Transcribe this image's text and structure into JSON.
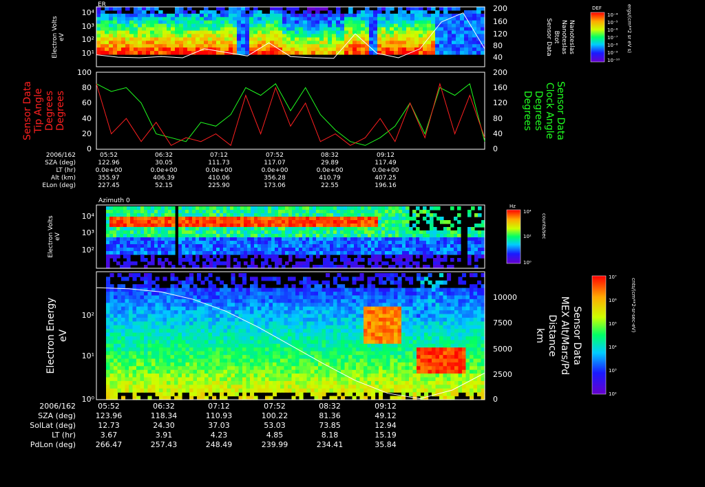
{
  "panel1": {
    "label": "ER",
    "ylabel_left": [
      "Electron Volts",
      "eV"
    ],
    "y_ticks": [
      "10⁴",
      "10³",
      "10²",
      "10¹"
    ],
    "y_right_ticks": [
      "200",
      "160",
      "120",
      "80",
      "40"
    ],
    "ylabel_right": [
      "Sensor Data",
      "Btot",
      "Nanoteslas",
      "Nanoteslas"
    ],
    "colorbar_title": "DEF",
    "colorbar_ticks": [
      "10⁻⁴",
      "10⁻⁵",
      "10⁻⁶",
      "10⁻⁷",
      "10⁻⁸",
      "10⁻⁹",
      "10⁻¹⁰"
    ],
    "colorbar_units": "ergs/(cm**2 sr eV s)"
  },
  "panel2": {
    "y_left_ticks": [
      "100",
      "80",
      "60",
      "40",
      "20",
      "0"
    ],
    "y_right_ticks": [
      "200",
      "160",
      "120",
      "80",
      "40",
      "0"
    ],
    "ylabel_left": [
      "Sensor Data",
      "Tip Angle",
      "Degrees",
      "Degrees"
    ],
    "ylabel_right": [
      "Sensor Data",
      "Clock Angle",
      "Degrees",
      "Degrees"
    ],
    "colors": {
      "tip": "#ff2020",
      "clock": "#20ff20"
    }
  },
  "table1": {
    "rows": [
      [
        "2006/162",
        "05:52",
        "06:32",
        "07:12",
        "07:52",
        "08:32",
        "09:12"
      ],
      [
        "SZA (deg)",
        "122.96",
        "30.05",
        "111.73",
        "117.07",
        "29.89",
        "117.49"
      ],
      [
        "LT (hr)",
        "0.0e+00",
        "0.0e+00",
        "0.0e+00",
        "0.0e+00",
        "0.0e+00",
        "0.0e+00"
      ],
      [
        "Alt (km)",
        "355.97",
        "406.39",
        "410.06",
        "356.28",
        "410.79",
        "407.25"
      ],
      [
        "ELon (deg)",
        "227.45",
        "52.15",
        "225.90",
        "173.06",
        "22.55",
        "196.16"
      ]
    ]
  },
  "panel3": {
    "title": "Azimuth 0",
    "ylabel": [
      "Electron Volts",
      "eV"
    ],
    "y_ticks": [
      "10⁴",
      "10³",
      "10²"
    ],
    "colorbar_title": "Hz",
    "colorbar_ticks": [
      "10⁴",
      "10²",
      "10⁰"
    ],
    "colorbar_units": "counts/sec"
  },
  "panel4": {
    "ylabel_left": [
      "Electron Energy",
      "eV"
    ],
    "y_ticks": [
      "10²",
      "10¹",
      "10⁰"
    ],
    "y_right_ticks": [
      "10000",
      "7500",
      "5000",
      "2500",
      "0"
    ],
    "ylabel_right": [
      "Sensor Data",
      "MEX Alt/Mars/Pd",
      "Distance",
      "km"
    ],
    "colorbar_ticks": [
      "10⁷",
      "10⁶",
      "10⁵",
      "10⁴",
      "10³",
      "10²"
    ],
    "colorbar_units": "cnts/(cm**2-sr-sec-eV)"
  },
  "table2": {
    "rows": [
      [
        "2006/162",
        "05:52",
        "06:32",
        "07:12",
        "07:52",
        "08:32",
        "09:12"
      ],
      [
        "SZA (deg)",
        "123.96",
        "118.34",
        "110.93",
        "100.22",
        "81.36",
        "49.12"
      ],
      [
        "SolLat (deg)",
        "12.73",
        "24.30",
        "37.03",
        "53.03",
        "73.85",
        "12.94"
      ],
      [
        "LT (hr)",
        "3.67",
        "3.91",
        "4.23",
        "4.85",
        "8.18",
        "15.19"
      ],
      [
        "PdLon (deg)",
        "266.47",
        "257.43",
        "248.49",
        "239.99",
        "234.41",
        "35.84"
      ]
    ]
  },
  "chart_data": [
    {
      "type": "heatmap",
      "title": "ER",
      "ylabel": "Electron Volts eV",
      "ylim": [
        1,
        20000
      ],
      "x": [
        "05:52",
        "06:32",
        "07:12",
        "07:52",
        "08:32",
        "09:12"
      ],
      "overlay_series": {
        "name": "Btot",
        "right_ylim": [
          0,
          200
        ],
        "values": [
          40,
          32,
          30,
          34,
          30,
          60,
          48,
          36,
          80,
          34,
          30,
          28,
          110,
          45,
          30,
          60,
          150,
          180,
          60
        ]
      }
    },
    {
      "type": "line",
      "x": [
        "05:52",
        "06:32",
        "07:12",
        "07:52",
        "08:32",
        "09:12"
      ],
      "ylim": [
        0,
        100
      ],
      "right_ylim": [
        0,
        200
      ],
      "series": [
        {
          "name": "Tip Angle",
          "values": [
            85,
            20,
            40,
            10,
            35,
            5,
            15,
            10,
            20,
            5,
            70,
            20,
            80,
            30,
            60,
            10,
            20,
            5,
            15,
            40,
            10,
            60,
            15,
            85,
            20,
            70,
            15
          ]
        },
        {
          "name": "Clock Angle",
          "values": [
            170,
            150,
            160,
            120,
            40,
            30,
            20,
            70,
            60,
            90,
            160,
            140,
            170,
            100,
            160,
            90,
            50,
            20,
            10,
            30,
            60,
            120,
            40,
            160,
            140,
            170,
            20
          ]
        }
      ]
    },
    {
      "type": "heatmap",
      "title": "Azimuth 0",
      "ylabel": "Electron Volts eV",
      "ylim": [
        10,
        20000
      ],
      "x": [
        "05:52",
        "06:32",
        "07:12",
        "07:52",
        "08:32",
        "09:12"
      ]
    },
    {
      "type": "heatmap",
      "ylabel": "Electron Energy eV",
      "ylim": [
        1,
        1000
      ],
      "x": [
        "05:52",
        "06:32",
        "07:12",
        "07:52",
        "08:32",
        "09:12"
      ],
      "overlay_series": {
        "name": "MEX Alt/Mars/Pd Distance",
        "right_ylim": [
          0,
          12000
        ],
        "values": [
          10500,
          10400,
          10100,
          9400,
          8300,
          6800,
          5100,
          3400,
          1800,
          600,
          100,
          900,
          2500
        ]
      }
    }
  ]
}
